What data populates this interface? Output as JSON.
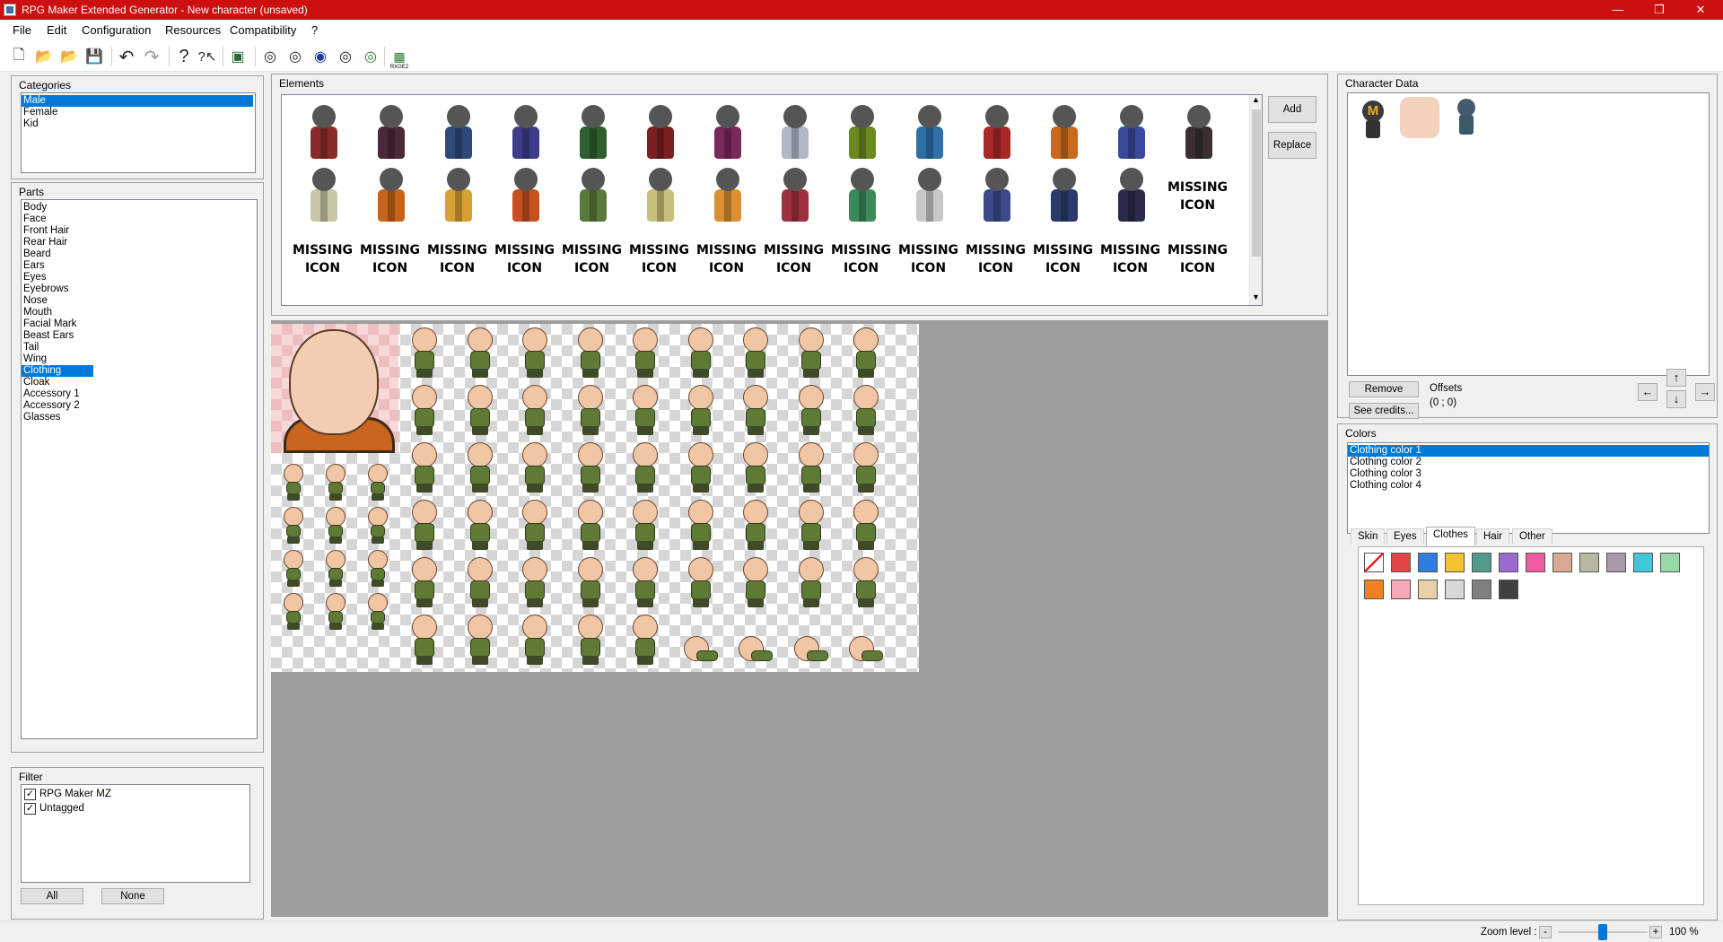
{
  "window": {
    "title": "RPG Maker Extended Generator - New character (unsaved)",
    "controls": {
      "minimize": "—",
      "restore": "❐",
      "close": "✕"
    }
  },
  "menu": [
    "File",
    "Edit",
    "Configuration",
    "Resources",
    "Compatibility",
    "?"
  ],
  "toolbar": {
    "icons": [
      "new-file-icon",
      "open-folder-icon",
      "open-recent-icon",
      "save-icon",
      "undo-icon",
      "redo-icon",
      "help-icon",
      "context-help-icon",
      "export-icon",
      "random-icon-1",
      "random-icon-2",
      "random-icon-3",
      "random-icon-4",
      "random-icon-5",
      "rmxp-export-icon"
    ],
    "glyphs": [
      "🗋",
      "📂",
      "📂",
      "💾",
      "↶",
      "↷",
      "?",
      "?↖",
      "▣",
      "◎",
      "◎",
      "◉",
      "◎",
      "◎",
      "▦"
    ],
    "rmxp_label": "RXGE2"
  },
  "categories": {
    "title": "Categories",
    "items": [
      "Male",
      "Female",
      "Kid"
    ],
    "selected": "Male"
  },
  "parts": {
    "title": "Parts",
    "items": [
      "Body",
      "Face",
      "Front Hair",
      "Rear Hair",
      "Beard",
      "Ears",
      "Eyes",
      "Eyebrows",
      "Nose",
      "Mouth",
      "Facial Mark",
      "Beast Ears",
      "Tail",
      "Wing",
      "Clothing",
      "Cloak",
      "Accessory 1",
      "Accessory 2",
      "Glasses"
    ],
    "selected": "Clothing"
  },
  "filter": {
    "title": "Filter",
    "items": [
      {
        "label": "RPG Maker MZ",
        "checked": true
      },
      {
        "label": "Untagged",
        "checked": true
      }
    ],
    "all_label": "All",
    "none_label": "None"
  },
  "elements": {
    "title": "Elements",
    "add_label": "Add",
    "replace_label": "Replace",
    "missing_line1": "MISSING",
    "missing_line2": "ICON",
    "row1_colors": [
      "#8a2b2b",
      "#4a2a3a",
      "#2e4a7a",
      "#3d3d8a",
      "#2f5e2f",
      "#7a2020",
      "#7a2a5a",
      "#b0b8c8",
      "#6a8a20",
      "#2f6fa8",
      "#a82828",
      "#c86a1a",
      "#3a4a9a",
      "#3a3030"
    ],
    "row2_colors": [
      "#c8c8a8",
      "#c86418",
      "#d8a030",
      "#c85020",
      "#5a7a3a",
      "#c8c07a",
      "#d89030",
      "#a03040",
      "#3a8a5a",
      "#c8c8c8",
      "#3a4a8a",
      "#2a3a6a",
      "#2a2a4a"
    ]
  },
  "character_data": {
    "title": "Character Data",
    "remove_label": "Remove",
    "offsets_label": "Offsets",
    "credits_label": "See credits...",
    "offset_value": "(0 ; 0)",
    "arrows": {
      "up": "↑",
      "down": "↓",
      "left": "←",
      "right": "→"
    },
    "badge_letter": "M"
  },
  "colors": {
    "title": "Colors",
    "items": [
      "Clothing color 1",
      "Clothing color 2",
      "Clothing color 3",
      "Clothing color 4"
    ],
    "selected": "Clothing color 1",
    "tabs": [
      "Skin",
      "Eyes",
      "Clothes",
      "Hair",
      "Other"
    ],
    "active_tab": "Clothes",
    "swatches_row1": [
      "none",
      "#e04646",
      "#2f7de0",
      "#f2c230",
      "#4f9a8a",
      "#9a6ad0",
      "#f05aa0",
      "#d8a890",
      "#b8b8a0",
      "#a898a8",
      "#40c8d8",
      "#98d8a8"
    ],
    "swatches_row2": [
      "#f08020",
      "#f4a8b8",
      "#e8d0a8",
      "#d8d8d8",
      "#808080",
      "#404040"
    ]
  },
  "status": {
    "zoom_label": "Zoom level :",
    "zoom_minus": "-",
    "zoom_plus": "+",
    "zoom_value": "100 %",
    "zoom_level": 0.5
  }
}
